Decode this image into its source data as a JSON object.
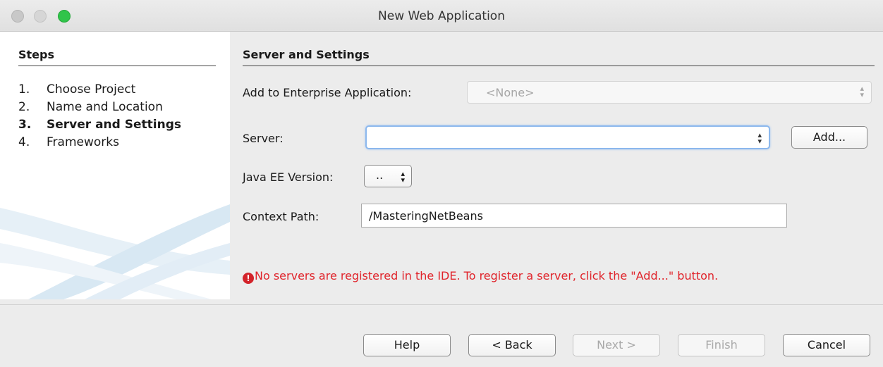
{
  "window": {
    "title": "New Web Application",
    "accent_color": "#e0242b"
  },
  "steps": {
    "header": "Steps",
    "items": [
      {
        "num": "1.",
        "label": "Choose Project",
        "active": false
      },
      {
        "num": "2.",
        "label": "Name and Location",
        "active": false
      },
      {
        "num": "3.",
        "label": "Server and Settings",
        "active": true
      },
      {
        "num": "4.",
        "label": "Frameworks",
        "active": false
      }
    ]
  },
  "main": {
    "section_header": "Server and Settings",
    "enterprise_label": "Add to Enterprise Application:",
    "enterprise_value": "<None>",
    "server_label": "Server:",
    "server_value": "",
    "add_button": "Add...",
    "javaee_label": "Java EE Version:",
    "javaee_value": "..",
    "context_label": "Context Path:",
    "context_value": "/MasteringNetBeans",
    "error_message": "No servers are registered in the IDE. To register a server, click the \"Add...\" button.",
    "error_icon": "!"
  },
  "footer": {
    "help": "Help",
    "back": "< Back",
    "next": "Next >",
    "finish": "Finish",
    "cancel": "Cancel"
  }
}
